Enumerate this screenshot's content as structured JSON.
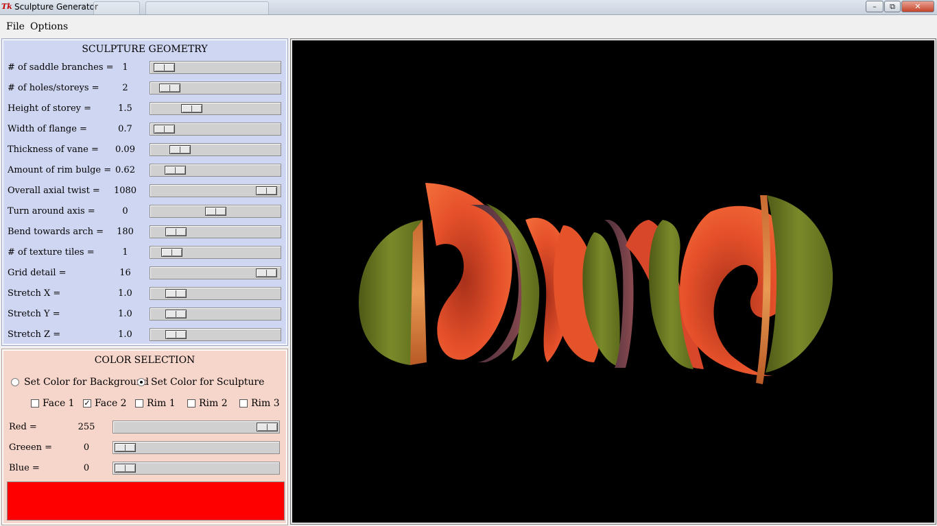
{
  "window": {
    "title": "Sculpture Generator"
  },
  "menu": {
    "file": "File",
    "options": "Options"
  },
  "geometry": {
    "title": "SCULPTURE GEOMETRY",
    "rows": [
      {
        "label": "# of saddle branches =",
        "value": "1",
        "slider_fraction": 0.02
      },
      {
        "label": "# of holes/storeys =",
        "value": "2",
        "slider_fraction": 0.07
      },
      {
        "label": "Height of storey =",
        "value": "1.5",
        "slider_fraction": 0.28
      },
      {
        "label": "Width of flange =",
        "value": "0.7",
        "slider_fraction": 0.02
      },
      {
        "label": "Thickness of vane =",
        "value": "0.09",
        "slider_fraction": 0.17
      },
      {
        "label": "Amount of rim bulge =",
        "value": "0.62",
        "slider_fraction": 0.12
      },
      {
        "label": "Overall axial twist =",
        "value": "1080",
        "slider_fraction": 0.98
      },
      {
        "label": "Turn around axis =",
        "value": "0",
        "slider_fraction": 0.5
      },
      {
        "label": "Bend towards arch =",
        "value": "180",
        "slider_fraction": 0.13
      },
      {
        "label": "# of texture tiles =",
        "value": "1",
        "slider_fraction": 0.09
      },
      {
        "label": "Grid detail =",
        "value": "16",
        "slider_fraction": 0.98
      },
      {
        "label": "Stretch X =",
        "value": "1.0",
        "slider_fraction": 0.13
      },
      {
        "label": "Stretch Y =",
        "value": "1.0",
        "slider_fraction": 0.13
      },
      {
        "label": "Stretch Z =",
        "value": "1.0",
        "slider_fraction": 0.13
      }
    ]
  },
  "color": {
    "title": "COLOR SELECTION",
    "radio_background": "Set Color for Background",
    "radio_sculpture": "Set Color for Sculpture",
    "selected_radio": "sculpture",
    "checks": [
      {
        "label": "Face 1",
        "checked": false
      },
      {
        "label": "Face 2",
        "checked": true
      },
      {
        "label": "Rim 1",
        "checked": false
      },
      {
        "label": "Rim 2",
        "checked": false
      },
      {
        "label": "Rim 3",
        "checked": false
      }
    ],
    "channels": [
      {
        "label": "Red =",
        "value": "255",
        "slider_fraction": 1.0
      },
      {
        "label": "Greeen =",
        "value": "0",
        "slider_fraction": 0.0
      },
      {
        "label": "Blue =",
        "value": "0",
        "slider_fraction": 0.0
      }
    ],
    "swatch_color": "#ff0000"
  },
  "viewport": {
    "background": "#000000"
  }
}
